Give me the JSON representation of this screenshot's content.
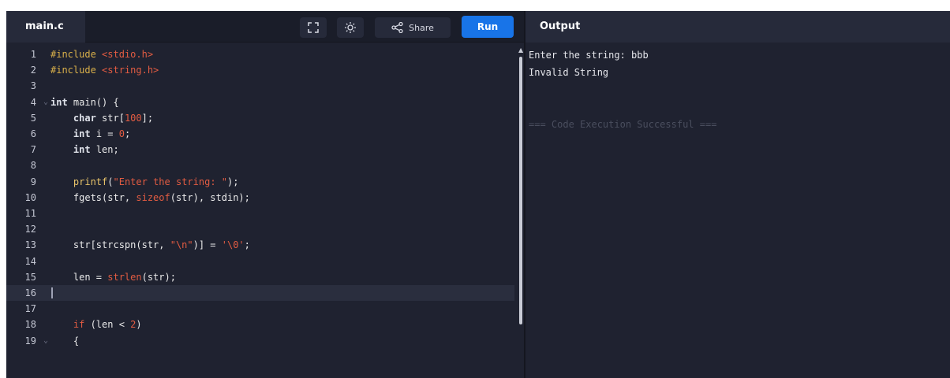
{
  "editor": {
    "file_tab": "main.c",
    "toolbar": {
      "fullscreen_icon": "fullscreen-icon",
      "theme_icon": "sun-icon",
      "share_icon": "share-icon",
      "share_label": "Share",
      "run_label": "Run"
    },
    "active_line": 16,
    "lines": [
      {
        "num": "1",
        "tokens": [
          {
            "t": "#include ",
            "c": "pp"
          },
          {
            "t": "<stdio.h>",
            "c": "str"
          }
        ]
      },
      {
        "num": "2",
        "tokens": [
          {
            "t": "#include ",
            "c": "pp"
          },
          {
            "t": "<string.h>",
            "c": "str"
          }
        ]
      },
      {
        "num": "3",
        "tokens": []
      },
      {
        "num": "4",
        "fold": true,
        "tokens": [
          {
            "t": "int",
            "c": "kw"
          },
          {
            "t": " main() {",
            "c": ""
          }
        ]
      },
      {
        "num": "5",
        "tokens": [
          {
            "t": "    ",
            "c": ""
          },
          {
            "t": "char",
            "c": "kw"
          },
          {
            "t": " str[",
            "c": ""
          },
          {
            "t": "100",
            "c": "num"
          },
          {
            "t": "];",
            "c": ""
          }
        ]
      },
      {
        "num": "6",
        "tokens": [
          {
            "t": "    ",
            "c": ""
          },
          {
            "t": "int",
            "c": "kw"
          },
          {
            "t": " i = ",
            "c": ""
          },
          {
            "t": "0",
            "c": "num"
          },
          {
            "t": ";",
            "c": ""
          }
        ]
      },
      {
        "num": "7",
        "tokens": [
          {
            "t": "    ",
            "c": ""
          },
          {
            "t": "int",
            "c": "kw"
          },
          {
            "t": " len;",
            "c": ""
          }
        ]
      },
      {
        "num": "8",
        "tokens": []
      },
      {
        "num": "9",
        "tokens": [
          {
            "t": "    ",
            "c": ""
          },
          {
            "t": "printf",
            "c": "fn"
          },
          {
            "t": "(",
            "c": ""
          },
          {
            "t": "\"Enter the string: \"",
            "c": "str"
          },
          {
            "t": ");",
            "c": ""
          }
        ]
      },
      {
        "num": "10",
        "tokens": [
          {
            "t": "    fgets(str, ",
            "c": ""
          },
          {
            "t": "sizeof",
            "c": "str"
          },
          {
            "t": "(str), stdin);",
            "c": ""
          }
        ]
      },
      {
        "num": "11",
        "tokens": []
      },
      {
        "num": "12",
        "tokens": []
      },
      {
        "num": "13",
        "tokens": [
          {
            "t": "    str[strcspn(str, ",
            "c": ""
          },
          {
            "t": "\"\\n\"",
            "c": "str"
          },
          {
            "t": ")] = ",
            "c": ""
          },
          {
            "t": "'\\0'",
            "c": "str"
          },
          {
            "t": ";",
            "c": ""
          }
        ]
      },
      {
        "num": "14",
        "tokens": []
      },
      {
        "num": "15",
        "tokens": [
          {
            "t": "    len = ",
            "c": ""
          },
          {
            "t": "strlen",
            "c": "str"
          },
          {
            "t": "(str);",
            "c": ""
          }
        ]
      },
      {
        "num": "16",
        "tokens": []
      },
      {
        "num": "17",
        "tokens": []
      },
      {
        "num": "18",
        "tokens": [
          {
            "t": "    ",
            "c": ""
          },
          {
            "t": "if",
            "c": "str"
          },
          {
            "t": " (len < ",
            "c": ""
          },
          {
            "t": "2",
            "c": "num"
          },
          {
            "t": ")",
            "c": ""
          }
        ]
      },
      {
        "num": "19",
        "fold": true,
        "tokens": [
          {
            "t": "    {",
            "c": ""
          }
        ]
      }
    ]
  },
  "output": {
    "title": "Output",
    "lines": [
      {
        "text": "Enter the string: bbb",
        "style": "normal"
      },
      {
        "text": "Invalid String",
        "style": "normal"
      },
      {
        "text": "",
        "style": "normal"
      },
      {
        "text": "",
        "style": "normal"
      },
      {
        "text": "=== Code Execution Successful ===",
        "style": "success"
      }
    ]
  },
  "colors": {
    "background": "#1f2230",
    "header": "#262a3a",
    "run_button": "#1874e8",
    "string": "#e35c42",
    "preprocessor": "#d9b04a"
  }
}
